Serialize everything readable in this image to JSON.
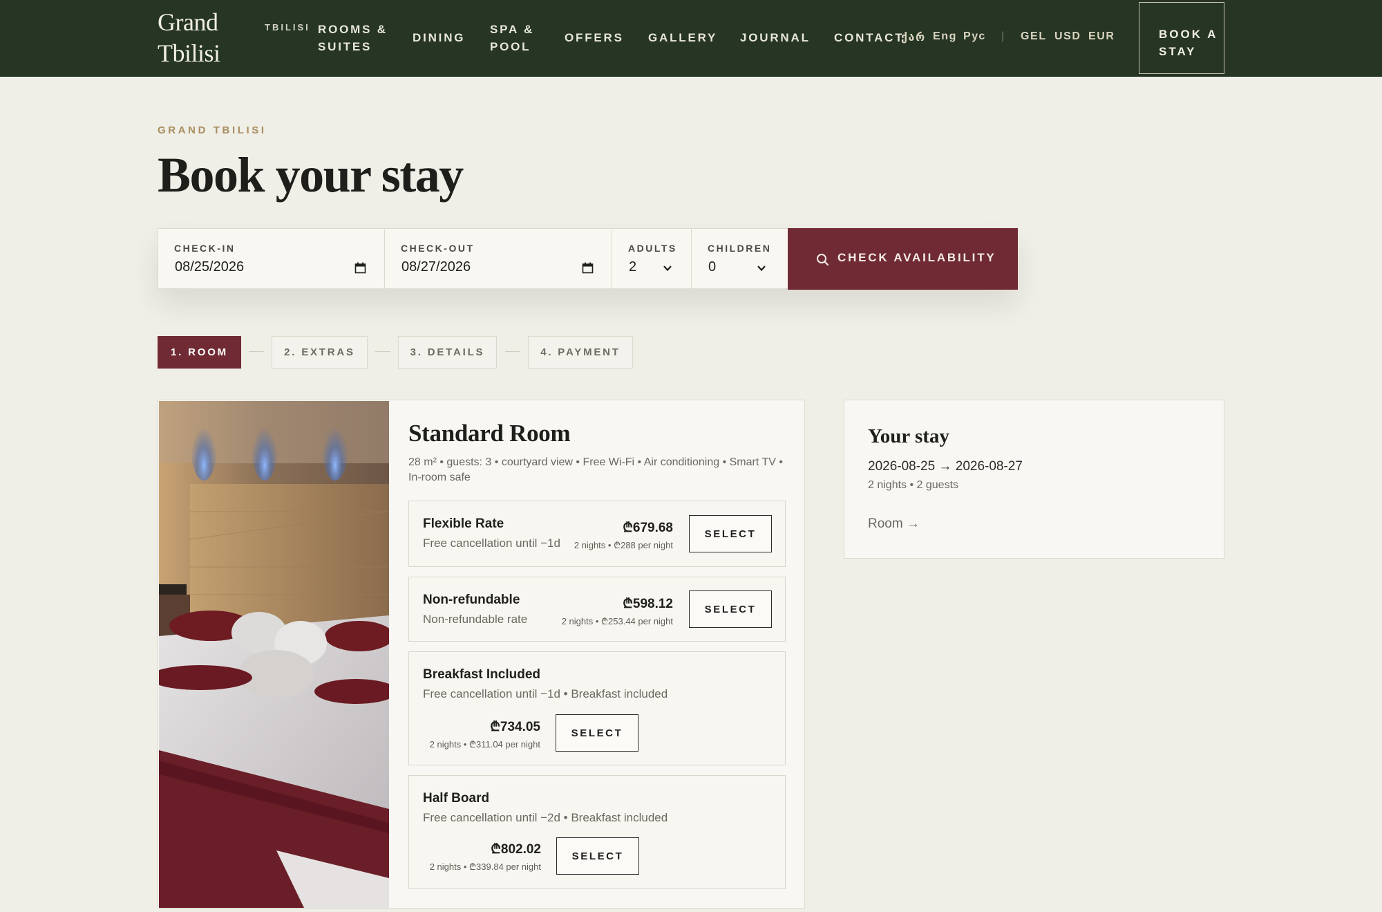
{
  "header": {
    "brand": [
      "Grand",
      "Tbilisi"
    ],
    "nav": {
      "tbilisi": "TBILISI",
      "rooms": "ROOMS & SUITES",
      "dining": "DINING",
      "spa": "SPA & POOL",
      "offers": "OFFERS",
      "gallery": "GALLERY",
      "journal": "JOURNAL",
      "contact": "CONTACT"
    },
    "languages": [
      "ქარ",
      "Eng",
      "Рус"
    ],
    "separator": "|",
    "currencies": [
      "GEL",
      "USD",
      "EUR"
    ],
    "book_button": "BOOK A STAY"
  },
  "hero": {
    "eyebrow": "GRAND TBILISI",
    "title": "Book your stay"
  },
  "search": {
    "checkin_label": "CHECK-IN",
    "checkin_value": "08/25/2026",
    "checkout_label": "CHECK-OUT",
    "checkout_value": "08/27/2026",
    "adults_label": "ADULTS",
    "adults_value": "2",
    "children_label": "CHILDREN",
    "children_value": "0",
    "button_label": "CHECK AVAILABILITY"
  },
  "steps": [
    {
      "label": "1. ROOM",
      "active": true
    },
    {
      "label": "2. EXTRAS",
      "active": false
    },
    {
      "label": "3. DETAILS",
      "active": false
    },
    {
      "label": "4. PAYMENT",
      "active": false
    }
  ],
  "room": {
    "name": "Standard Room",
    "meta": "28 m² • guests: 3 • courtyard view • Free Wi-Fi • Air conditioning • Smart TV • In-room safe",
    "rates": [
      {
        "name": "Flexible Rate",
        "sub": "Free cancellation until −1d",
        "price": "₾679.68",
        "nightly": "2 nights • ₾288 per night",
        "button": "SELECT"
      },
      {
        "name": "Non-refundable",
        "sub": "Non-refundable rate",
        "price": "₾598.12",
        "nightly": "2 nights • ₾253.44 per night",
        "button": "SELECT"
      },
      {
        "name": "Breakfast Included",
        "sub": "Free cancellation until −1d • Breakfast included",
        "price": "₾734.05",
        "nightly": "2 nights • ₾311.04 per night",
        "button": "SELECT"
      },
      {
        "name": "Half Board",
        "sub": "Free cancellation until −2d • Breakfast included",
        "price": "₾802.02",
        "nightly": "2 nights • ₾339.84 per night",
        "button": "SELECT"
      }
    ]
  },
  "summary": {
    "title": "Your stay",
    "dates": "2026-08-25 → 2026-08-27",
    "info": "2 nights • 2 guests",
    "room_link": "Room →"
  },
  "colors": {
    "header_bg": "#263524",
    "accent": "#702a33",
    "page_bg": "#efeee7",
    "eyebrow": "#a98e5e"
  }
}
